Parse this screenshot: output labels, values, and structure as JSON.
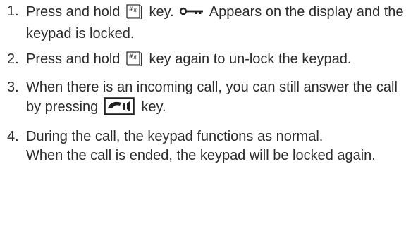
{
  "list": [
    {
      "num": "1.",
      "part1": "Press and hold",
      "part2": "key.",
      "part3": "Appears on the display and the keypad is locked."
    },
    {
      "num": "2.",
      "part1": "Press and hold",
      "part2": "key again to un-lock the keypad."
    },
    {
      "num": "3.",
      "part1": "When there is an incoming call, you can still answer the call by pressing",
      "part2": "key."
    },
    {
      "num": "4.",
      "line1": "During the call, the keypad functions as normal.",
      "line2": "When the call is ended, the keypad will be locked again."
    }
  ],
  "icons": {
    "hash_key_label": "#",
    "hash_key_sub": "ß"
  }
}
